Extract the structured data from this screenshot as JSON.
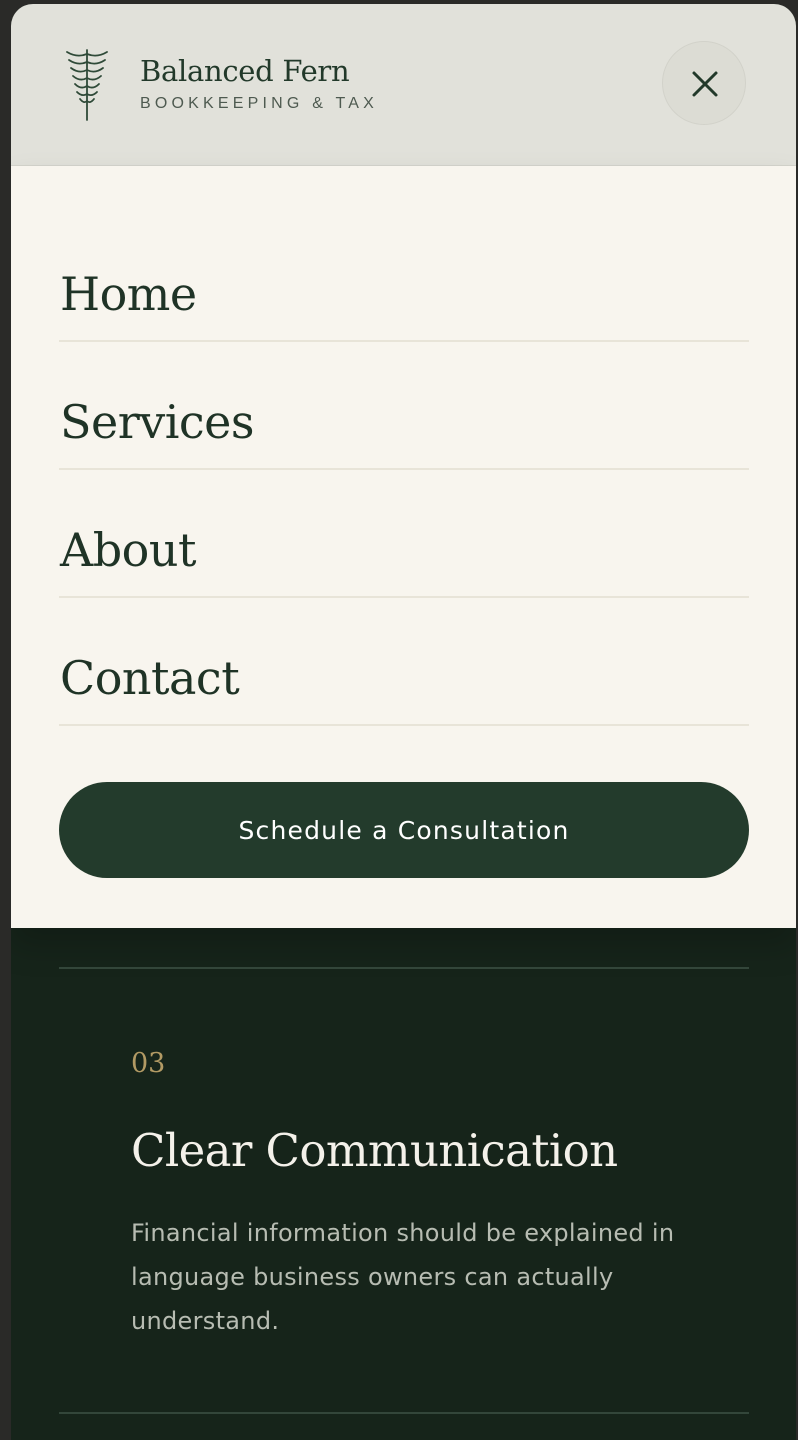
{
  "header": {
    "brand_name": "Balanced Fern",
    "brand_tagline": "BOOKKEEPING & TAX",
    "logo_icon": "fern-icon",
    "close_icon": "close-icon"
  },
  "menu": {
    "items": [
      {
        "label": "Home"
      },
      {
        "label": "Services"
      },
      {
        "label": "About"
      },
      {
        "label": "Contact"
      }
    ],
    "cta_label": "Schedule a Consultation"
  },
  "feature": {
    "number": "03",
    "title": "Clear Communication",
    "text": "Financial information should be explained in language business owners can actually understand."
  },
  "colors": {
    "header_bg": "#e1e1da",
    "menu_bg": "#f8f5ee",
    "primary_green": "#233b2c",
    "dark_bg": "#16241a",
    "accent_gold": "#b29a64"
  }
}
